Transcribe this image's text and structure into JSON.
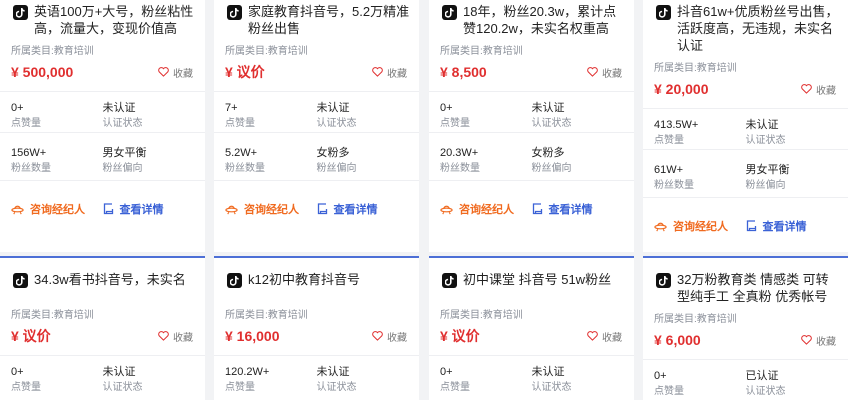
{
  "labels": {
    "category_prefix": "所属类目:",
    "favorite": "收藏",
    "likes": "点赞量",
    "cert_status": "认证状态",
    "fans_count": "粉丝数量",
    "fans_bias": "粉丝偏向",
    "consult": "咨询经纪人",
    "detail": "查看详情"
  },
  "colors": {
    "price": "#e02f2f",
    "consult": "#f06a1f",
    "detail": "#3b62d6",
    "accent_border": "#4d6fd6"
  },
  "cards": [
    {
      "title": "英语100万+大号，粉丝粘性高，流量大，变现价值高",
      "category": "所属类目:教育培训",
      "price": "¥ 500,000",
      "likes": "0+",
      "cert": "未认证",
      "fans": "156W+",
      "bias": "男女平衡"
    },
    {
      "title": "家庭教育抖音号，5.2万精准粉丝出售",
      "category": "所属类目:教育培训",
      "price": "¥ 议价",
      "likes": "7+",
      "cert": "未认证",
      "fans": "5.2W+",
      "bias": "女粉多"
    },
    {
      "title": "18年，粉丝20.3w，累计点赞120.2w，未实名权重高",
      "category": "所属类目:教育培训",
      "price": "¥ 8,500",
      "likes": "0+",
      "cert": "未认证",
      "fans": "20.3W+",
      "bias": "女粉多"
    },
    {
      "title": "抖音61w+优质粉丝号出售，活跃度高，无违规，未实名认证",
      "category": "所属类目:教育培训",
      "price": "¥ 20,000",
      "likes": "413.5W+",
      "cert": "未认证",
      "fans": "61W+",
      "bias": "男女平衡"
    },
    {
      "title": "34.3w看书抖音号，未实名",
      "category": "所属类目:教育培训",
      "price": "¥ 议价",
      "likes": "0+",
      "cert": "未认证"
    },
    {
      "title": "k12初中教育抖音号",
      "category": "所属类目:教育培训",
      "price": "¥ 16,000",
      "likes": "120.2W+",
      "cert": "未认证"
    },
    {
      "title": "初中课堂 抖音号 51w粉丝",
      "category": "所属类目:教育培训",
      "price": "¥ 议价",
      "likes": "0+",
      "cert": "未认证"
    },
    {
      "title": "32万粉教育类 情感类 可转型纯手工 全真粉 优秀帐号",
      "category": "所属类目:教育培训",
      "price": "¥ 6,000",
      "likes": "0+",
      "cert": "已认证"
    }
  ]
}
